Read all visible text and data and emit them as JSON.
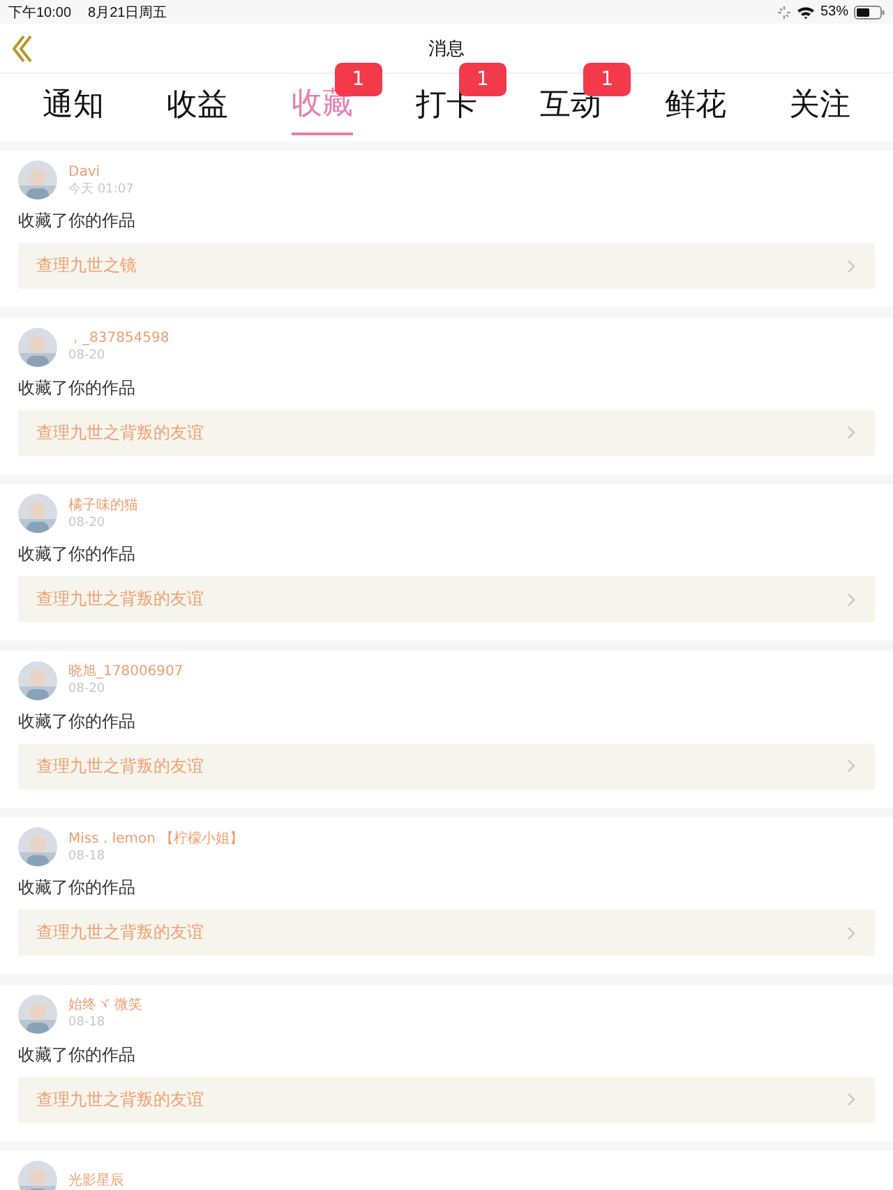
{
  "status_bar": {
    "time": "下午10:00",
    "date": "8月21日周五",
    "battery": "53%"
  },
  "nav": {
    "title": "消息"
  },
  "tabs": [
    {
      "label": "通知",
      "selected": false
    },
    {
      "label": "收益",
      "selected": false
    },
    {
      "label": "收藏",
      "selected": true,
      "badge": "1"
    },
    {
      "label": "打卡",
      "selected": false,
      "badge": "1"
    },
    {
      "label": "互动",
      "selected": false,
      "badge": "1"
    },
    {
      "label": "鲜花",
      "selected": false
    },
    {
      "label": "关注",
      "selected": false
    }
  ],
  "messages": [
    {
      "user": "Davi",
      "time": "今天 01:07",
      "action": "收藏了你的作品",
      "work": "查理九世之镜"
    },
    {
      "user": "，_837854598",
      "time": "08-20",
      "action": "收藏了你的作品",
      "work": "查理九世之背叛的友谊"
    },
    {
      "user": "橘子味的猫",
      "time": "08-20",
      "action": "收藏了你的作品",
      "work": "查理九世之背叛的友谊"
    },
    {
      "user": "晓旭_178006907",
      "time": "08-20",
      "action": "收藏了你的作品",
      "work": "查理九世之背叛的友谊"
    },
    {
      "user": "Miss . lemon 【柠檬小姐】",
      "time": "08-18",
      "action": "收藏了你的作品",
      "work": "查理九世之背叛的友谊"
    },
    {
      "user": "始终ヾ 微笑",
      "time": "08-18",
      "action": "收藏了你的作品",
      "work": "查理九世之背叛的友谊"
    },
    {
      "user": "光影星辰"
    }
  ]
}
